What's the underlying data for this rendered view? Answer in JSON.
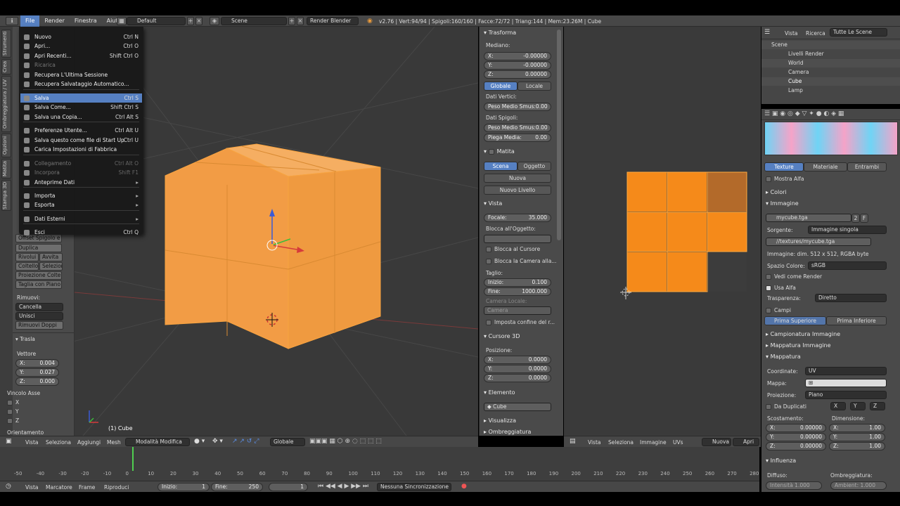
{
  "topbar": {
    "menus": [
      "File",
      "Render",
      "Finestra",
      "Aiuto"
    ],
    "layout": "Default",
    "scene": "Scene",
    "engine": "Render Blender",
    "stats": "v2.76 | Vert:94/94 | Spigoli:160/160 | Facce:72/72 | Triang:144 | Mem:23.26M | Cube"
  },
  "file_menu": {
    "items": [
      {
        "label": "Nuovo",
        "shortcut": "Ctrl N",
        "disabled": false
      },
      {
        "label": "Apri...",
        "shortcut": "Ctrl O",
        "disabled": false
      },
      {
        "label": "Apri Recenti...",
        "shortcut": "Shift Ctrl O",
        "disabled": false
      },
      {
        "label": "Ricarica",
        "shortcut": "",
        "disabled": true
      },
      {
        "label": "Recupera L'Ultima Sessione",
        "shortcut": "",
        "disabled": false
      },
      {
        "label": "Recupera Salvataggio Automatico...",
        "shortcut": "",
        "disabled": false
      },
      {
        "label": "Salva",
        "shortcut": "Ctrl S",
        "disabled": false
      },
      {
        "label": "Salva Come...",
        "shortcut": "Shift Ctrl S",
        "disabled": false
      },
      {
        "label": "Salva una Copia...",
        "shortcut": "Ctrl Alt S",
        "disabled": false
      },
      {
        "label": "Preferenze Utente...",
        "shortcut": "Ctrl Alt U",
        "disabled": false
      },
      {
        "label": "Salva questo come file di Start Up",
        "shortcut": "Ctrl U",
        "disabled": false
      },
      {
        "label": "Carica Impostazioni di Fabbrica",
        "shortcut": "",
        "disabled": false
      },
      {
        "label": "Collegamento",
        "shortcut": "Ctrl Alt O",
        "disabled": true
      },
      {
        "label": "Incorpora",
        "shortcut": "Shift F1",
        "disabled": true
      },
      {
        "label": "Anteprime Dati",
        "shortcut": "",
        "disabled": false
      },
      {
        "label": "Importa",
        "shortcut": "",
        "disabled": false
      },
      {
        "label": "Esporta",
        "shortcut": "",
        "disabled": false
      },
      {
        "label": "Dati Esterni",
        "shortcut": "",
        "disabled": false
      },
      {
        "label": "Esci",
        "shortcut": "Ctrl Q",
        "disabled": false
      }
    ]
  },
  "toolshelf": {
    "tabs": [
      "Strumenti",
      "Crea",
      "Ombreggiatura / UV",
      "Opzioni",
      "Matita",
      "Stampa 3D"
    ],
    "buttons": [
      "Offset Spigolo e ...",
      "Duplica",
      "Rivolui",
      "Avvita",
      "Coltello",
      "Selezion",
      "Proiezione Coltello",
      "Taglia con Piano"
    ],
    "rimuovi_label": "Rimuovi:",
    "cancella": "Cancella",
    "unisci": "Unisci",
    "rimuovi_doppi": "Rimuovi Doppi",
    "trasla_title": "Trasla",
    "vettore_label": "Vettore",
    "vector": [
      {
        "axis": "X:",
        "value": "0.004"
      },
      {
        "axis": "Y:",
        "value": "0.027"
      },
      {
        "axis": "Z:",
        "value": "0.000"
      }
    ],
    "vincolo_label": "Vincolo Asse",
    "axes": [
      "X",
      "Y",
      "Z"
    ],
    "orientamento": "Orientamento"
  },
  "viewport": {
    "object_label": "(1) Cube",
    "header": {
      "menus": [
        "Vista",
        "Seleziona",
        "Aggiungi",
        "Mesh"
      ],
      "mode": "Modalità Modifica",
      "orientation": "Globale"
    }
  },
  "npanel": {
    "trasformazione": "Trasforma",
    "mediano": "Mediano:",
    "median": [
      {
        "axis": "X:",
        "value": "-0.00000"
      },
      {
        "axis": "Y:",
        "value": "-0.00000"
      },
      {
        "axis": "Z:",
        "value": "0.00000"
      }
    ],
    "globale": "Globale",
    "locale": "Locale",
    "dati_vertici": "Dati Vertici:",
    "peso_vert": {
      "label": "Peso Medio Smus:",
      "value": "0.00"
    },
    "dati_spigoli": "Dati Spigoli:",
    "peso_spig": {
      "label": "Peso Medio Smus:",
      "value": "0.00"
    },
    "piega": {
      "label": "Piega Media:",
      "value": "0.00"
    },
    "matita": "Matita",
    "scena": "Scena",
    "oggetto": "Oggetto",
    "nuova": "Nuova",
    "nuovo_livello": "Nuovo Livello",
    "vista": "Vista",
    "focale": {
      "label": "Focale:",
      "value": "35.000"
    },
    "blocca_oggetto": "Blocca all'Oggetto:",
    "blocca_cursore": "Blocca al Cursore",
    "blocca_camera": "Blocca la Camera alla...",
    "taglio": "Taglio:",
    "inizio": {
      "label": "Inizio:",
      "value": "0.100"
    },
    "fine": {
      "label": "Fine:",
      "value": "1000.000"
    },
    "camera_locale": "Camera Locale:",
    "camera": "Camera",
    "imposta_confine": "Imposta confine del r...",
    "cursore3d": "Cursore 3D",
    "posizione": "Posizione:",
    "cursor": [
      {
        "axis": "X:",
        "value": "0.0000"
      },
      {
        "axis": "Y:",
        "value": "0.0000"
      },
      {
        "axis": "Z:",
        "value": "0.0000"
      }
    ],
    "elemento": "Elemento",
    "cube": "Cube",
    "visualizza": "Visualizza",
    "ombreggiatura": "Ombreggiatura"
  },
  "uv": {
    "menus": [
      "Vista",
      "Seleziona",
      "Immagine",
      "UVs"
    ],
    "nuova": "Nuova",
    "apri": "Apri"
  },
  "outliner": {
    "menus": [
      "Vista",
      "Ricerca"
    ],
    "filter": "Tutte Le Scene",
    "items": [
      "Scene",
      "Livelli Render",
      "World",
      "Camera",
      "Cube",
      "Lamp"
    ]
  },
  "props": {
    "tabs": [
      "Texture",
      "Materiale",
      "Entrambi"
    ],
    "mostra_alfa": "Mostra Alfa",
    "colori": "Colori",
    "immagine": "Immagine",
    "image_name": "mycube.tga",
    "users": "2",
    "fake": "F",
    "sorgente_label": "Sorgente:",
    "sorgente": "Immagine singola",
    "path": "//textures/mycube.tga",
    "info": "Immagine: dim. 512 x 512, RGBA byte",
    "spazio_label": "Spazio Colore:",
    "spazio": "sRGB",
    "vedi_render": "Vedi come Render",
    "usa_alfa": "Usa Alfa",
    "trasparenza_label": "Trasparenza:",
    "trasparenza": "Diretto",
    "campi": "Campi",
    "prima_sup": "Prima Superiore",
    "prima_inf": "Prima Inferiore",
    "campionatura": "Campionatura Immagine",
    "mappatura_img": "Mappatura Immagine",
    "mappatura": "Mappatura",
    "coordinate_label": "Coordinate:",
    "coordinate": "UV",
    "mappa_label": "Mappa:",
    "proiezione_label": "Proiezione:",
    "proiezione": "Piano",
    "da_duplicati": "Da Duplicati",
    "xyz": [
      "X",
      "Y",
      "Z"
    ],
    "scostamento": "Scostamento:",
    "dimensione": "Dimensione:",
    "offset": [
      {
        "axis": "X:",
        "value": "0.00000"
      },
      {
        "axis": "Y:",
        "value": "0.00000"
      },
      {
        "axis": "Z:",
        "value": "0.00000"
      }
    ],
    "size": [
      {
        "axis": "X:",
        "value": "1.00"
      },
      {
        "axis": "Y:",
        "value": "1.00"
      },
      {
        "axis": "Z:",
        "value": "1.00"
      }
    ],
    "influenza": "Influenza",
    "diffuso": "Diffuso:",
    "ombreggiatura": "Ombreggiatura:",
    "intensita": "Intensità  1.000",
    "ambient": "Ambient: 1.000"
  },
  "timeline": {
    "ticks": [
      "-50",
      "-40",
      "-30",
      "-20",
      "-10",
      "0",
      "10",
      "20",
      "30",
      "40",
      "50",
      "60",
      "70",
      "80",
      "90",
      "100",
      "110",
      "120",
      "130",
      "140",
      "150",
      "160",
      "170",
      "180",
      "190",
      "200",
      "210",
      "220",
      "230",
      "240",
      "250",
      "260",
      "270",
      "280"
    ],
    "menus": [
      "Vista",
      "Marcatore",
      "Frame",
      "Riproduci"
    ],
    "inizio": {
      "label": "Inizio:",
      "value": "1"
    },
    "fine": {
      "label": "Fine:",
      "value": "250"
    },
    "current": "1",
    "sync": "Nessuna Sincronizzazione",
    "current_frame": 1
  },
  "colors": {
    "accent": "#5680c2",
    "orange": "#f5a04a",
    "edge": "#ffa020"
  }
}
